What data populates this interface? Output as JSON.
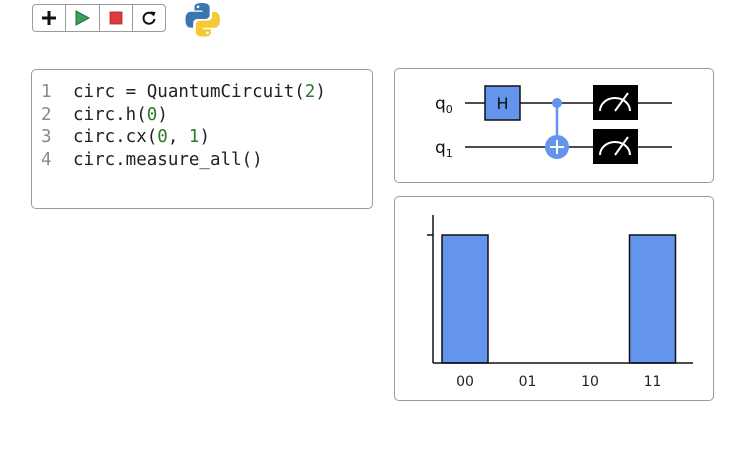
{
  "toolbar": {
    "buttons": [
      {
        "name": "add",
        "icon": "plus-icon"
      },
      {
        "name": "run",
        "icon": "play-icon",
        "color": "#3aa35b"
      },
      {
        "name": "stop",
        "icon": "stop-icon",
        "color": "#e03a3a"
      },
      {
        "name": "restart",
        "icon": "refresh-icon"
      }
    ]
  },
  "editor": {
    "lines": [
      {
        "num": "1",
        "tokens": [
          {
            "t": "circ = QuantumCircuit(",
            "k": "id"
          },
          {
            "t": "2",
            "k": "num"
          },
          {
            "t": ")",
            "k": "id"
          }
        ]
      },
      {
        "num": "2",
        "tokens": [
          {
            "t": "circ.h(",
            "k": "id"
          },
          {
            "t": "0",
            "k": "num"
          },
          {
            "t": ")",
            "k": "id"
          }
        ]
      },
      {
        "num": "3",
        "tokens": [
          {
            "t": "circ.cx(",
            "k": "id"
          },
          {
            "t": "0",
            "k": "num"
          },
          {
            "t": ", ",
            "k": "id"
          },
          {
            "t": "1",
            "k": "num"
          },
          {
            "t": ")",
            "k": "id"
          }
        ]
      },
      {
        "num": "4",
        "tokens": [
          {
            "t": "circ.measure_all()",
            "k": "id"
          }
        ]
      }
    ]
  },
  "circuit": {
    "qubits": [
      {
        "base": "q",
        "sub": "0"
      },
      {
        "base": "q",
        "sub": "1"
      }
    ],
    "gates": {
      "h": {
        "label": "H"
      },
      "cx": {
        "control": 0,
        "target": 1
      },
      "measure": {
        "count": 2
      }
    },
    "colors": {
      "gate": "#6495ed",
      "measure": "#000000"
    }
  },
  "chart_data": {
    "type": "bar",
    "categories": [
      "00",
      "01",
      "10",
      "11"
    ],
    "values": [
      0.5,
      0,
      0,
      0.5
    ],
    "color": "#6495ed",
    "ylim": [
      0,
      0.5
    ]
  }
}
